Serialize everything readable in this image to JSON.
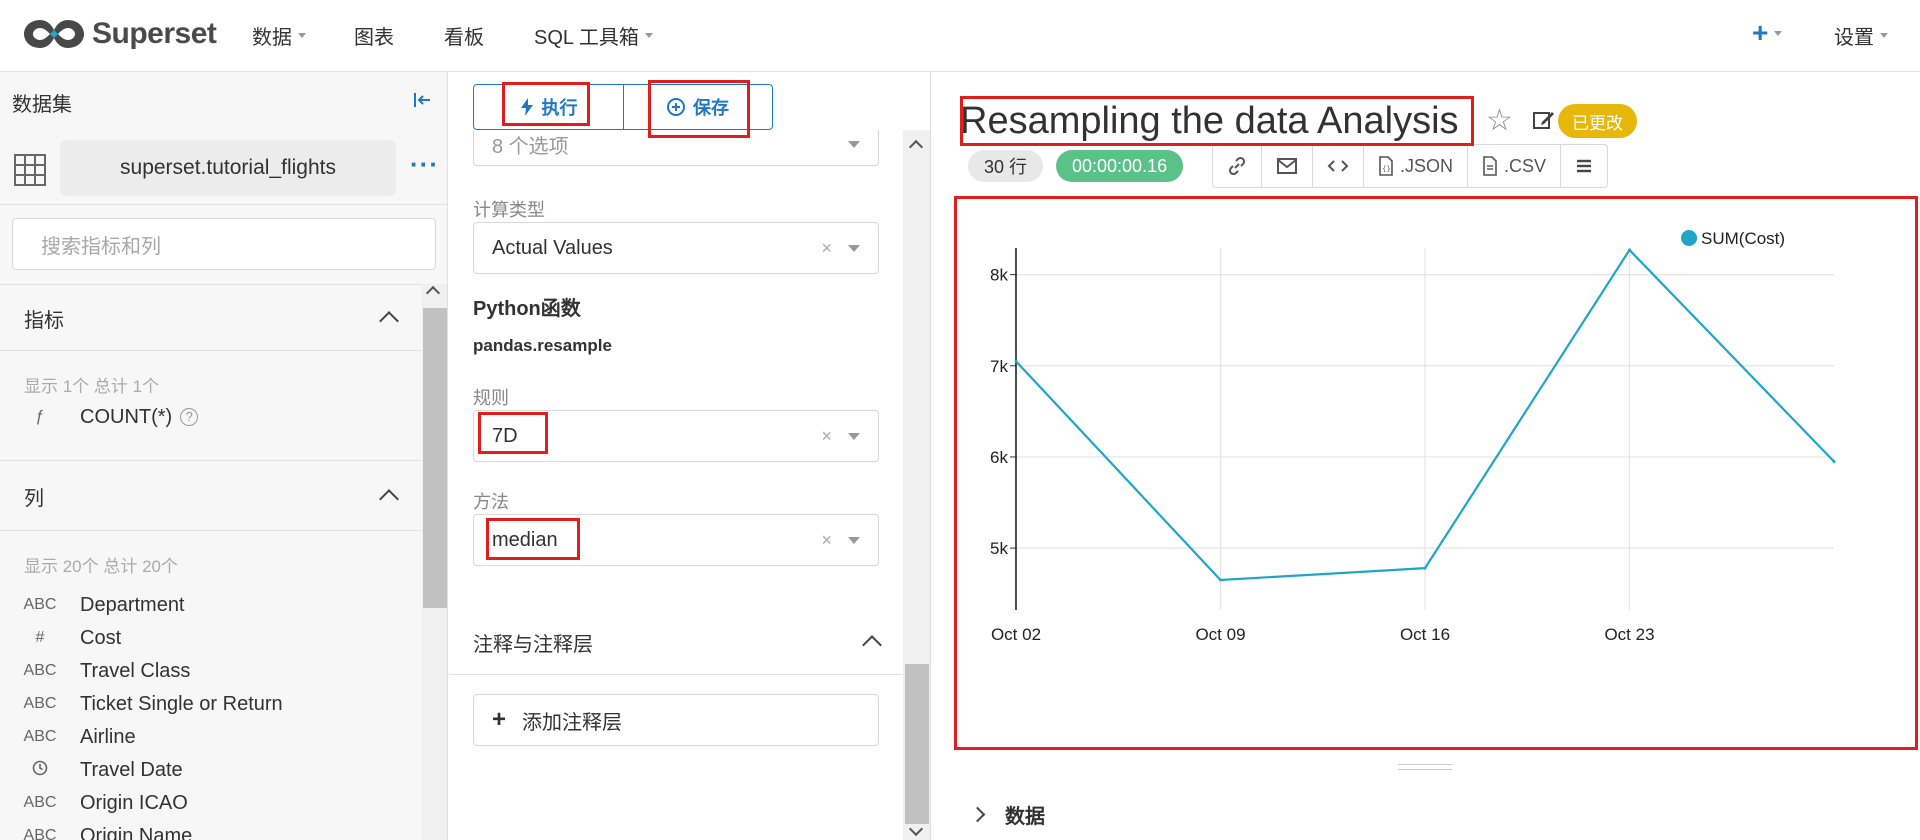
{
  "nav": {
    "brand": "Superset",
    "items": [
      {
        "label": "数据",
        "has_caret": true
      },
      {
        "label": "图表",
        "has_caret": false
      },
      {
        "label": "看板",
        "has_caret": false
      },
      {
        "label": "SQL 工具箱",
        "has_caret": true
      }
    ],
    "add_label": "+",
    "settings_label": "设置"
  },
  "dataset": {
    "header": "数据集",
    "name": "superset.tutorial_flights",
    "search_placeholder": "搜索指标和列",
    "metrics": {
      "title": "指标",
      "count_text": "显示 1个 总计 1个",
      "items": [
        {
          "type": "ƒ",
          "name": "COUNT(*)"
        }
      ]
    },
    "columns": {
      "title": "列",
      "count_text": "显示 20个 总计 20个",
      "items": [
        {
          "type": "ABC",
          "name": "Department"
        },
        {
          "type": "#",
          "name": "Cost"
        },
        {
          "type": "ABC",
          "name": "Travel Class"
        },
        {
          "type": "ABC",
          "name": "Ticket Single or Return"
        },
        {
          "type": "ABC",
          "name": "Airline"
        },
        {
          "type": "clock",
          "name": "Travel Date"
        },
        {
          "type": "ABC",
          "name": "Origin ICAO"
        },
        {
          "type": "ABC",
          "name": "Origin Name"
        }
      ]
    }
  },
  "controls": {
    "run_label": "执行",
    "save_label": "保存",
    "options_value": "8 个选项",
    "calc_type_label": "计算类型",
    "calc_type_value": "Actual Values",
    "python_title": "Python函数",
    "python_func": "pandas.resample",
    "rule_label": "规则",
    "rule_value": "7D",
    "method_label": "方法",
    "method_value": "median",
    "annotations_title": "注释与注释层",
    "add_annotation_label": "添加注释层",
    "clear_glyph": "×"
  },
  "chart_header": {
    "title": "Resampling the data Analysis",
    "changed_badge": "已更改",
    "rows_badge": "30 行",
    "time_badge": "00:00:00.16",
    "actions": [
      {
        "icon": "link-icon",
        "label": ""
      },
      {
        "icon": "mail-icon",
        "label": ""
      },
      {
        "icon": "code-icon",
        "label": ""
      },
      {
        "icon": "json-file-icon",
        "label": ".JSON"
      },
      {
        "icon": "csv-file-icon",
        "label": ".CSV"
      },
      {
        "icon": "menu-icon",
        "label": ""
      }
    ]
  },
  "data_section_label": "数据",
  "colors": {
    "accent": "#1f78c4",
    "series": "#1ea5c8",
    "highlight": "#e01e1e",
    "changed": "#e8b70c",
    "time_ok": "#5ac189"
  },
  "chart_data": {
    "type": "line",
    "x": [
      "2011-10-02",
      "2011-10-09",
      "2011-10-16",
      "2011-10-23",
      "2011-10-30"
    ],
    "x_tick_labels": [
      "Oct 02",
      "Oct 09",
      "Oct 16",
      "Oct 23"
    ],
    "series": [
      {
        "name": "SUM(Cost)",
        "values": [
          7050,
          4650,
          4780,
          8270,
          5950
        ]
      }
    ],
    "y_ticks": [
      5000,
      6000,
      7000,
      8000
    ],
    "y_tick_labels": [
      "5k",
      "6k",
      "7k",
      "8k"
    ],
    "ylim": [
      4650,
      8270
    ],
    "legend_position": "top-right",
    "grid": true
  }
}
